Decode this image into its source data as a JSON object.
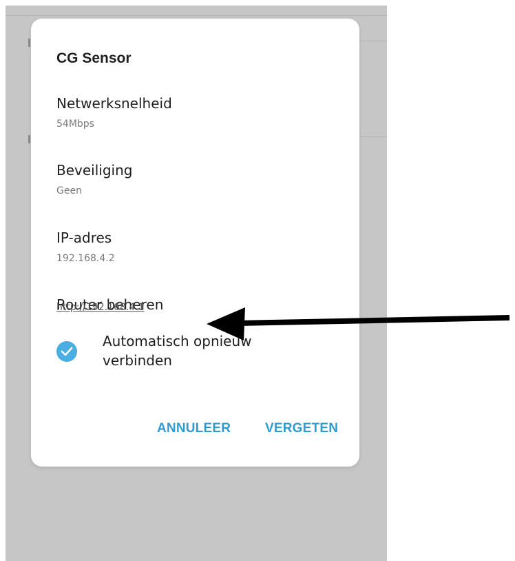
{
  "dialog": {
    "title": "CG Sensor",
    "rows": [
      {
        "label": "Netwerksnelheid",
        "value": "54Mbps"
      },
      {
        "label": "Beveiliging",
        "value": "Geen"
      },
      {
        "label": "IP-adres",
        "value": "192.168.4.2"
      }
    ],
    "router": {
      "label": "Router beheren",
      "link": "http://192.168.4.1"
    },
    "auto_reconnect": {
      "label_line1": "Automatisch opnieuw",
      "label_line2": "verbinden",
      "checked": true
    },
    "buttons": {
      "cancel": "ANNULEER",
      "forget": "VERGETEN"
    }
  },
  "colors": {
    "accent": "#2f9ccf",
    "checkbox": "#4aaee3",
    "overlay": "#c6c6c6",
    "annotation_arrow": "#000000"
  },
  "icons": {
    "checkbox": "checkmark-circle-icon",
    "annotation": "arrow-left-icon"
  }
}
